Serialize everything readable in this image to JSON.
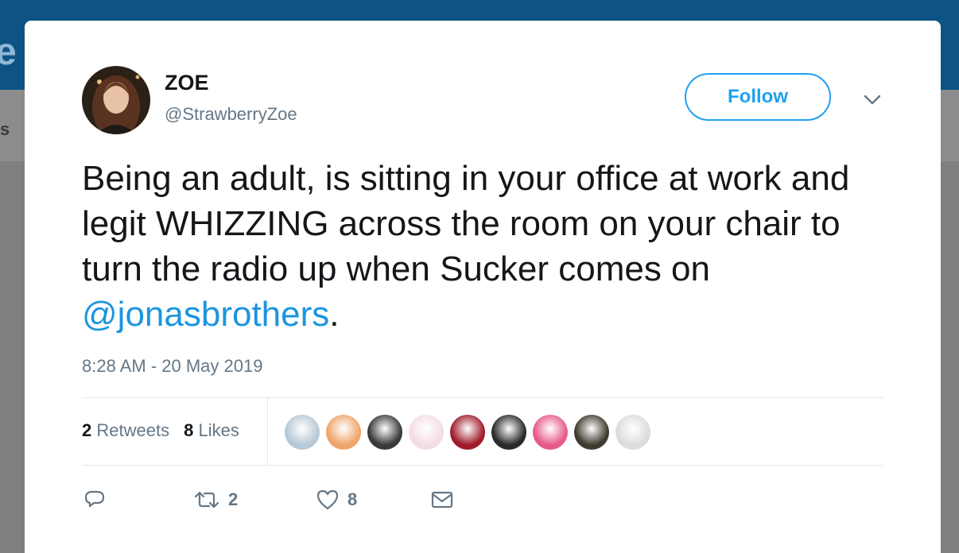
{
  "background": {
    "brand_fragment": "e",
    "nav_fragment": "s"
  },
  "tweet": {
    "author": {
      "display_name": "ZOE",
      "handle": "@StrawberryZoe"
    },
    "follow_label": "Follow",
    "text_parts": {
      "body": "Being an adult, is sitting in your office at work and legit WHIZZING across the room on your chair to turn the radio up when Sucker comes on ",
      "mention": "@jonasbrothers",
      "end": "."
    },
    "timestamp": "8:28 AM - 20 May 2019",
    "stats": {
      "retweets_count": "2",
      "retweets_label": "Retweets",
      "likes_count": "8",
      "likes_label": "Likes"
    },
    "likers": [
      {
        "name": "liker-1",
        "color": "#b7c9d6"
      },
      {
        "name": "liker-2",
        "color": "#f0a56a"
      },
      {
        "name": "liker-3",
        "color": "#3a3a3a"
      },
      {
        "name": "liker-4",
        "color": "#f3dde4"
      },
      {
        "name": "liker-5",
        "color": "#a01c2c"
      },
      {
        "name": "liker-6",
        "color": "#2a2a2a"
      },
      {
        "name": "liker-7",
        "color": "#e65a8a"
      },
      {
        "name": "liker-8",
        "color": "#3f3b2f"
      },
      {
        "name": "liker-9",
        "color": "#dcdcdc"
      }
    ],
    "actions": {
      "reply_icon": "reply-icon",
      "retweet_icon": "retweet-icon",
      "retweet_count": "2",
      "like_icon": "heart-icon",
      "like_count": "8",
      "dm_icon": "envelope-icon"
    },
    "colors": {
      "accent": "#1da1f2",
      "mention": "#1b95e0",
      "secondary_text": "#657786",
      "primary_text": "#14171a"
    }
  }
}
